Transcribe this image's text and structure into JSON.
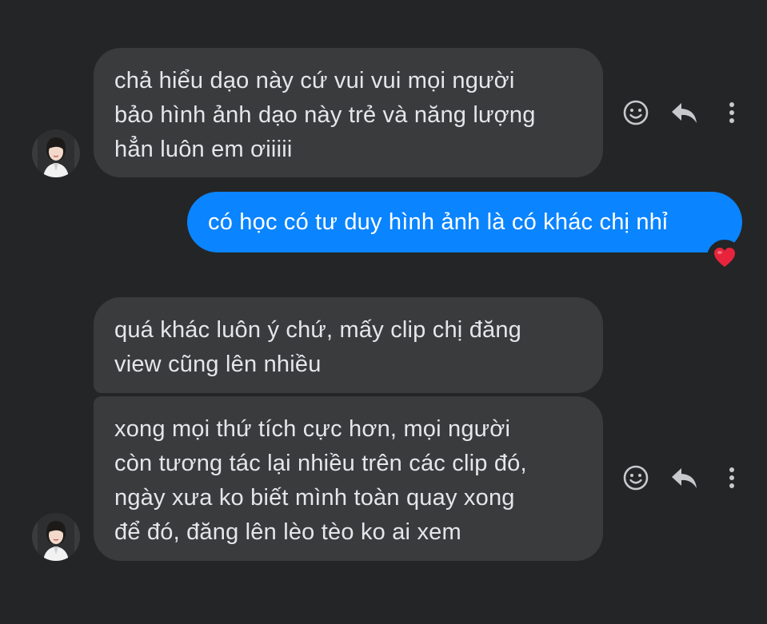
{
  "colors": {
    "background": "#242526",
    "incoming_bubble": "#3a3b3c",
    "outgoing_bubble": "#0a84ff",
    "text": "#e4e6eb",
    "icon": "#c8c9cc",
    "reaction": "#e8243c"
  },
  "messages": [
    {
      "sender": "other",
      "lines": [
        "chả hiểu dạo này cứ vui vui mọi người",
        "bảo hình ảnh dạo này trẻ và năng lượng",
        "hẳn luôn em ơiiiii"
      ]
    },
    {
      "sender": "me",
      "lines": [
        "có học có tư duy hình ảnh là có khác chị nhỉ"
      ],
      "reaction": "heart-icon"
    },
    {
      "sender": "other",
      "lines": [
        "quá khác luôn ý chứ, mấy clip chị đăng",
        "view cũng lên nhiều"
      ]
    },
    {
      "sender": "other",
      "lines": [
        "xong mọi thứ tích cực hơn, mọi người",
        "còn tương tác lại nhiều trên các clip đó,",
        "ngày xưa ko biết mình toàn quay xong",
        "để đó, đăng lên lèo tèo ko ai xem"
      ]
    }
  ],
  "icons": {
    "react": "smiley-icon",
    "reply": "reply-arrow-icon",
    "more": "more-vertical-icon",
    "avatar": "avatar"
  }
}
